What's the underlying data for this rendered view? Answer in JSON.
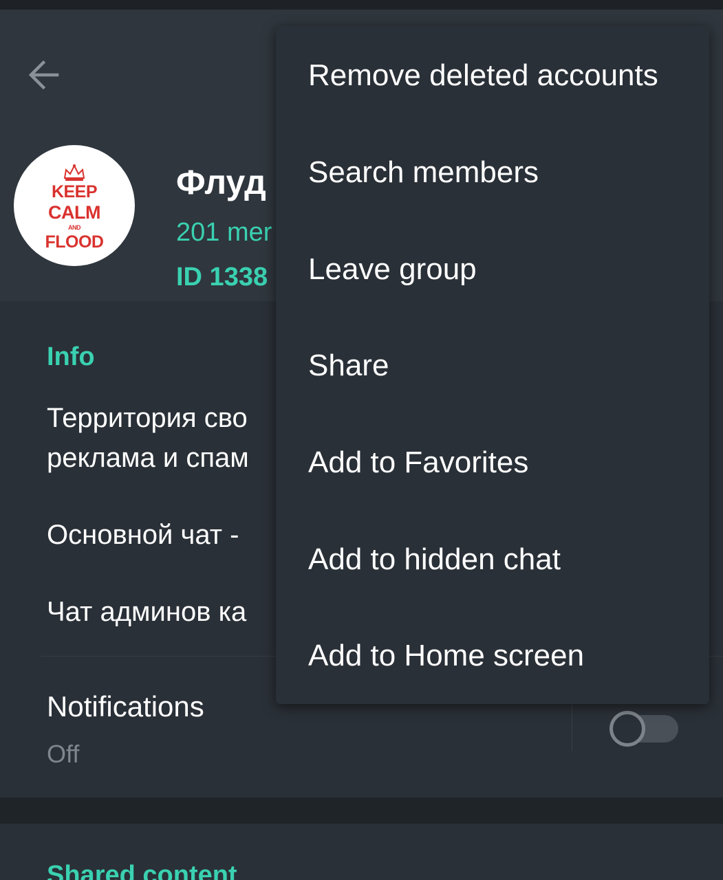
{
  "header": {
    "title": "Флуд",
    "members": "201 mer",
    "id": "ID 1338",
    "avatar": {
      "line1": "KEEP",
      "line2": "CALM",
      "line3": "AND",
      "line4": "FLOOD",
      "color": "#d9322e"
    }
  },
  "info": {
    "heading": "Info",
    "description_line1": "Территория сво",
    "description_line2": "реклама и спам",
    "link1": "Основной чат -",
    "link2": "Чат админов ка"
  },
  "notifications": {
    "label": "Notifications",
    "value": "Off",
    "enabled": false
  },
  "shared": {
    "heading": "Shared content"
  },
  "menu": {
    "items": [
      {
        "label": "Remove deleted accounts"
      },
      {
        "label": "Search members"
      },
      {
        "label": "Leave group"
      },
      {
        "label": "Share"
      },
      {
        "label": "Add to Favorites"
      },
      {
        "label": "Add to hidden chat"
      },
      {
        "label": "Add to Home screen"
      }
    ]
  },
  "colors": {
    "accent": "#3ad1b1",
    "background": "#2a3037",
    "header_background": "#2f363d"
  },
  "icons": {
    "back": "arrow-left-icon"
  }
}
